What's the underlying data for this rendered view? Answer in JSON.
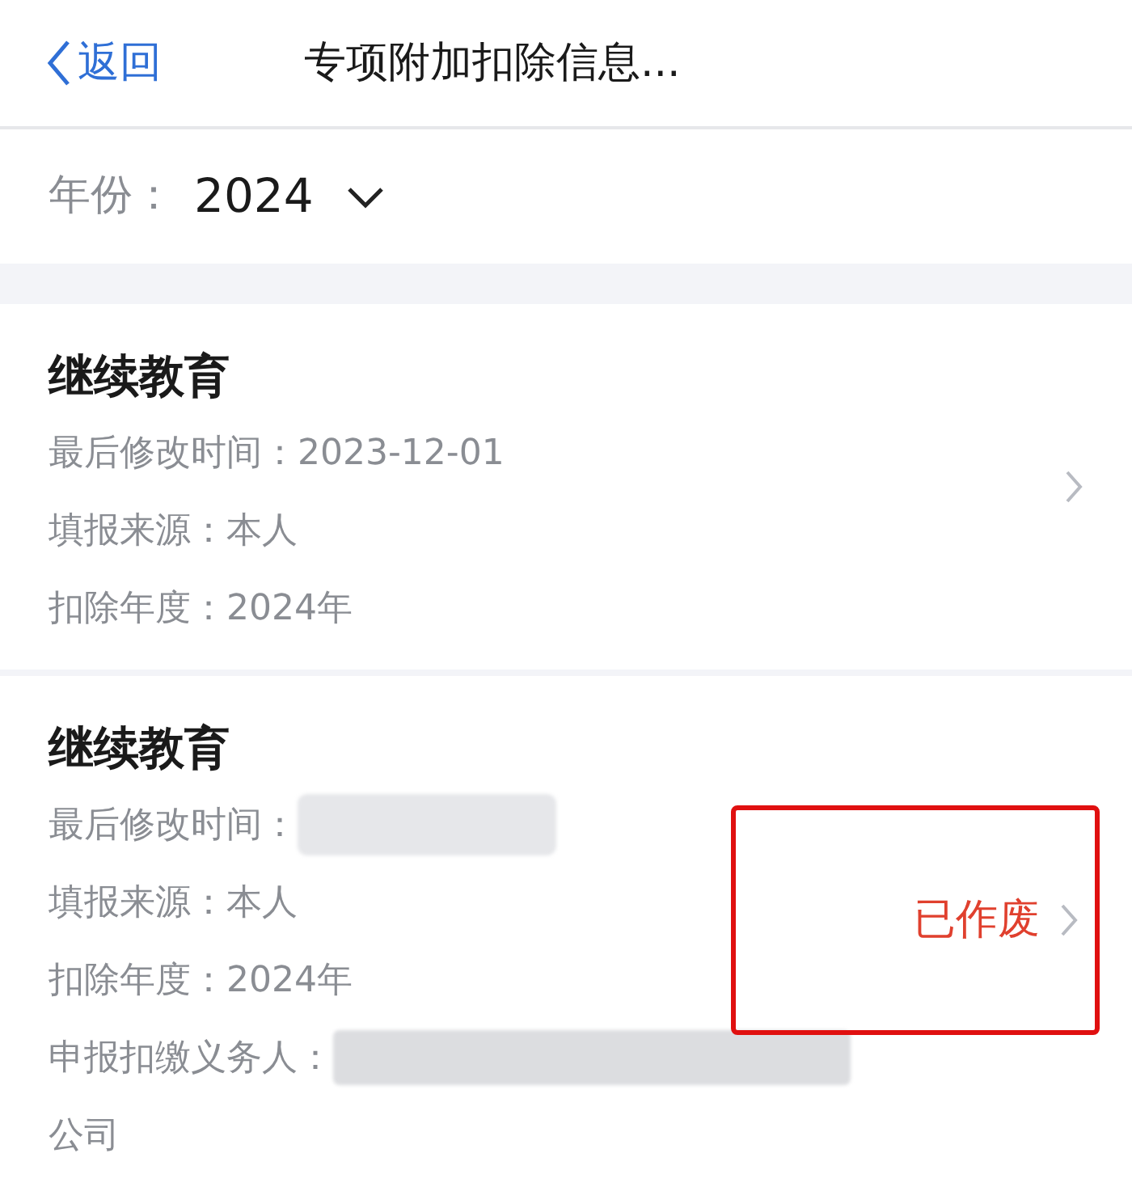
{
  "nav": {
    "back": "返回",
    "title": "专项附加扣除信息..."
  },
  "year_filter": {
    "label": "年份：",
    "value": "2024"
  },
  "records": [
    {
      "title": "继续教育",
      "annotated": false,
      "fields": [
        {
          "label": "最后修改时间：",
          "value": "2023-12-01",
          "redacted": false
        },
        {
          "label": "填报来源：",
          "value": "本人",
          "redacted": false
        },
        {
          "label": "扣除年度：",
          "value": "2024年",
          "redacted": false
        }
      ]
    },
    {
      "title": "继续教育",
      "status": "已作废",
      "annotated": true,
      "fields": [
        {
          "label": "最后修改时间：",
          "redacted": true
        },
        {
          "label": "填报来源：",
          "value": "本人",
          "redacted": false
        },
        {
          "label": "扣除年度：",
          "value": "2024年",
          "redacted": false
        },
        {
          "label": "申报扣缴义务人：",
          "redacted": true,
          "value_next_line": "公司"
        }
      ]
    }
  ]
}
